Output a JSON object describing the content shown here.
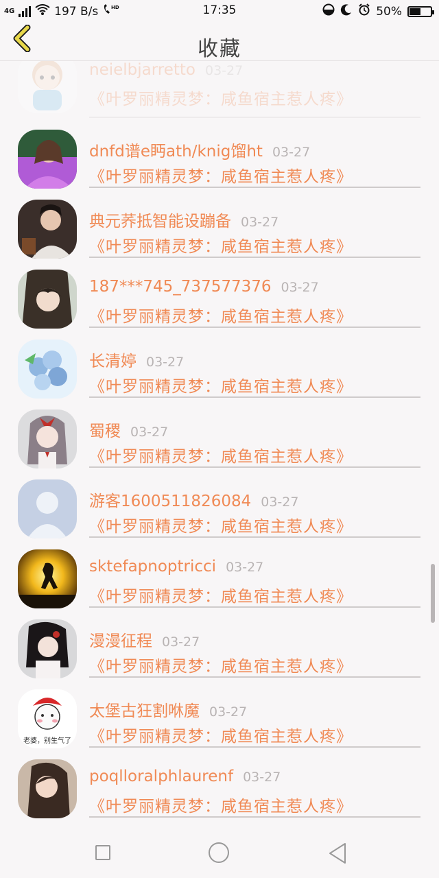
{
  "status": {
    "network": "4G",
    "speed": "197 B/s",
    "time": "17:35",
    "battery": "50%"
  },
  "header": {
    "title": "收藏"
  },
  "items": [
    {
      "name": "neielbjarretto",
      "date": "03-27",
      "book": "《叶罗丽精灵梦：咸鱼宿主惹人疼》"
    },
    {
      "name": "dnfd谱e眄ath/knig馏ht",
      "date": "03-27",
      "book": "《叶罗丽精灵梦：咸鱼宿主惹人疼》"
    },
    {
      "name": "典元荞抵智能设蹦备",
      "date": "03-27",
      "book": "《叶罗丽精灵梦：咸鱼宿主惹人疼》"
    },
    {
      "name": "187***745_737577376",
      "date": "03-27",
      "book": "《叶罗丽精灵梦：咸鱼宿主惹人疼》"
    },
    {
      "name": "长清婷",
      "date": "03-27",
      "book": "《叶罗丽精灵梦：咸鱼宿主惹人疼》"
    },
    {
      "name": "蜀稷",
      "date": "03-27",
      "book": "《叶罗丽精灵梦：咸鱼宿主惹人疼》"
    },
    {
      "name": "游客1600511826084",
      "date": "03-27",
      "book": "《叶罗丽精灵梦：咸鱼宿主惹人疼》"
    },
    {
      "name": "sktefapnoptricci",
      "date": "03-27",
      "book": "《叶罗丽精灵梦：咸鱼宿主惹人疼》"
    },
    {
      "name": "漫漫征程",
      "date": "03-27",
      "book": "《叶罗丽精灵梦：咸鱼宿主惹人疼》"
    },
    {
      "name": "太堡古狂割咻魔",
      "date": "03-27",
      "book": "《叶罗丽精灵梦：咸鱼宿主惹人疼》"
    },
    {
      "name": "poqlloralphlaurenf",
      "date": "03-27",
      "book": "《叶罗丽精灵梦：咸鱼宿主惹人疼》"
    }
  ],
  "avatar_sticker_text": "老婆，别生气了",
  "colors": {
    "accent": "#f08a55",
    "date": "#b9b4b4",
    "back_arrow": "#e8d84a"
  }
}
